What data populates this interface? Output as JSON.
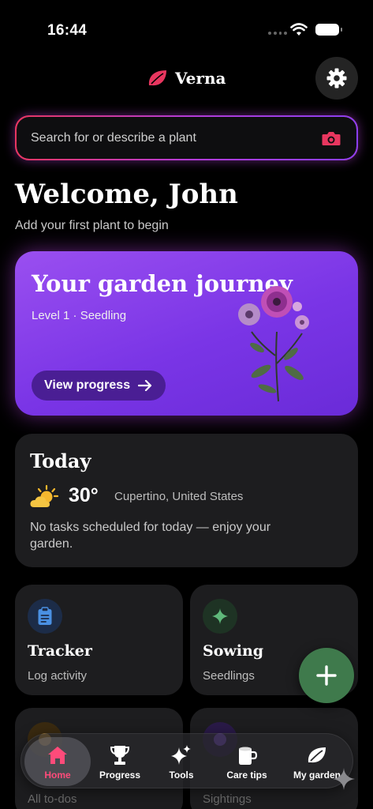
{
  "status_bar": {
    "time": "16:44"
  },
  "header": {
    "app_name": "Verna"
  },
  "search": {
    "placeholder": "Search for or describe a plant"
  },
  "welcome": {
    "title": "Welcome, John",
    "subtitle": "Add your first plant to begin"
  },
  "journey": {
    "title": "Your garden journey",
    "level": "Level 1 · Seedling",
    "button_label": "View progress"
  },
  "today": {
    "title": "Today",
    "weather_icon": "partly-cloudy-icon",
    "temperature": "30°",
    "location": "Cupertino, United States",
    "message": "No tasks scheduled for today — enjoy your garden."
  },
  "tiles": [
    {
      "title": "Tracker",
      "subtitle": "Log activity",
      "icon": "clipboard-icon",
      "icon_color": "#4a90e2"
    },
    {
      "title": "Sowing",
      "subtitle": "Seedlings",
      "icon": "sparkle-icon",
      "icon_color": "#5fb87a"
    },
    {
      "title": "",
      "subtitle": "All to-dos",
      "icon": "todo-icon",
      "icon_color": "#e0a030"
    },
    {
      "title": "",
      "subtitle": "Sightings",
      "icon": "sightings-icon",
      "icon_color": "#8a4ff0"
    }
  ],
  "nav": {
    "items": [
      {
        "label": "Home",
        "icon": "home-icon",
        "active": true
      },
      {
        "label": "Progress",
        "icon": "trophy-icon",
        "active": false
      },
      {
        "label": "Tools",
        "icon": "sparkles-icon",
        "active": false
      },
      {
        "label": "Care tips",
        "icon": "cup-icon",
        "active": false
      },
      {
        "label": "My garden",
        "icon": "leaf-icon",
        "active": false
      }
    ]
  },
  "colors": {
    "accent": "#ff4b7a",
    "journey_purple": "#7a35e6",
    "fab_green": "#3f7a4c",
    "card_bg": "#1d1d1f"
  }
}
